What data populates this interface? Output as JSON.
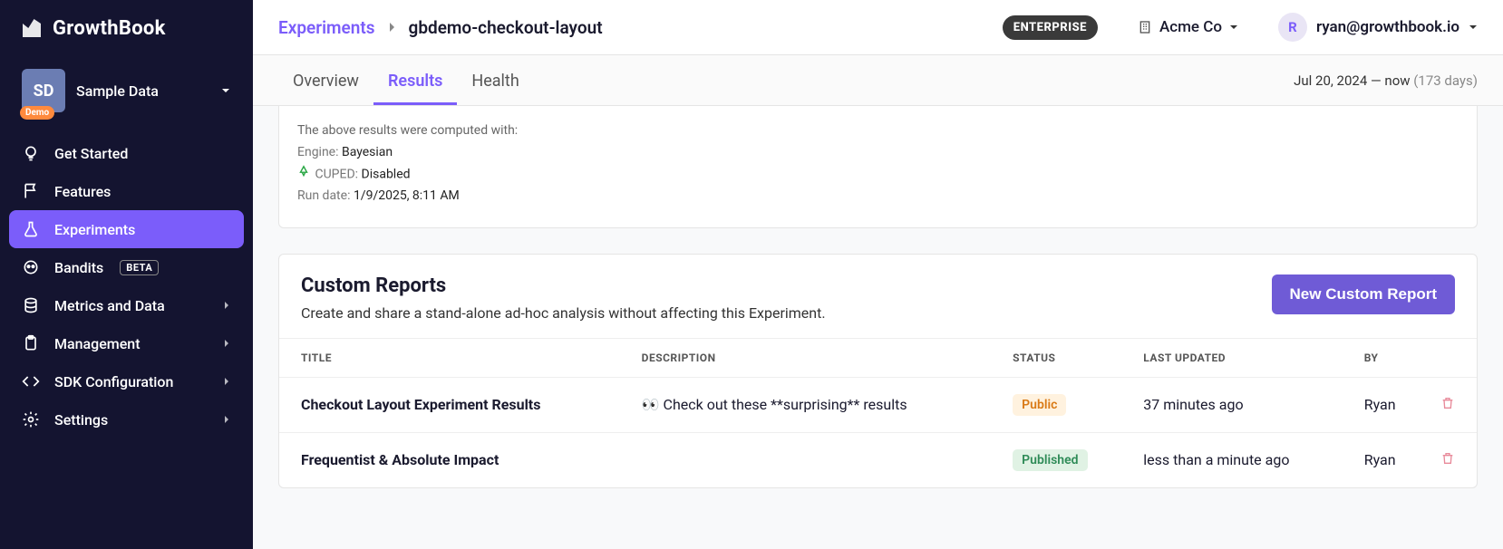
{
  "logo_text": "GrowthBook",
  "project": {
    "badge": "SD",
    "demo_label": "Demo",
    "name": "Sample Data"
  },
  "nav": {
    "get_started": "Get Started",
    "features": "Features",
    "experiments": "Experiments",
    "bandits": "Bandits",
    "bandits_beta": "BETA",
    "metrics": "Metrics and Data",
    "management": "Management",
    "sdk": "SDK Configuration",
    "settings": "Settings"
  },
  "breadcrumb": {
    "root": "Experiments",
    "leaf": "gbdemo-checkout-layout"
  },
  "enterprise_label": "ENTERPRISE",
  "org_name": "Acme Co",
  "user": {
    "initial": "R",
    "email": "ryan@growthbook.io"
  },
  "tabs": {
    "overview": "Overview",
    "results": "Results",
    "health": "Health"
  },
  "date_range": {
    "start": "Jul 20, 2024",
    "sep": " — ",
    "end": "now",
    "days": "(173 days)"
  },
  "computed": {
    "intro": "The above results were computed with:",
    "engine_label": "Engine: ",
    "engine_value": "Bayesian",
    "cuped_label": "CUPED: ",
    "cuped_value": "Disabled",
    "run_label": "Run date: ",
    "run_value": "1/9/2025, 8:11 AM"
  },
  "reports": {
    "title": "Custom Reports",
    "subtitle": "Create and share a stand-alone ad-hoc analysis without affecting this Experiment.",
    "new_btn": "New Custom Report",
    "columns": {
      "title": "TITLE",
      "description": "DESCRIPTION",
      "status": "STATUS",
      "last_updated": "LAST UPDATED",
      "by": "BY"
    },
    "rows": [
      {
        "title": "Checkout Layout Experiment Results",
        "description": "👀 Check out these **surprising** results",
        "status": "Public",
        "status_class": "status-public",
        "updated": "37 minutes ago",
        "by": "Ryan"
      },
      {
        "title": "Frequentist & Absolute Impact",
        "description": "",
        "status": "Published",
        "status_class": "status-published",
        "updated": "less than a minute ago",
        "by": "Ryan"
      }
    ]
  }
}
